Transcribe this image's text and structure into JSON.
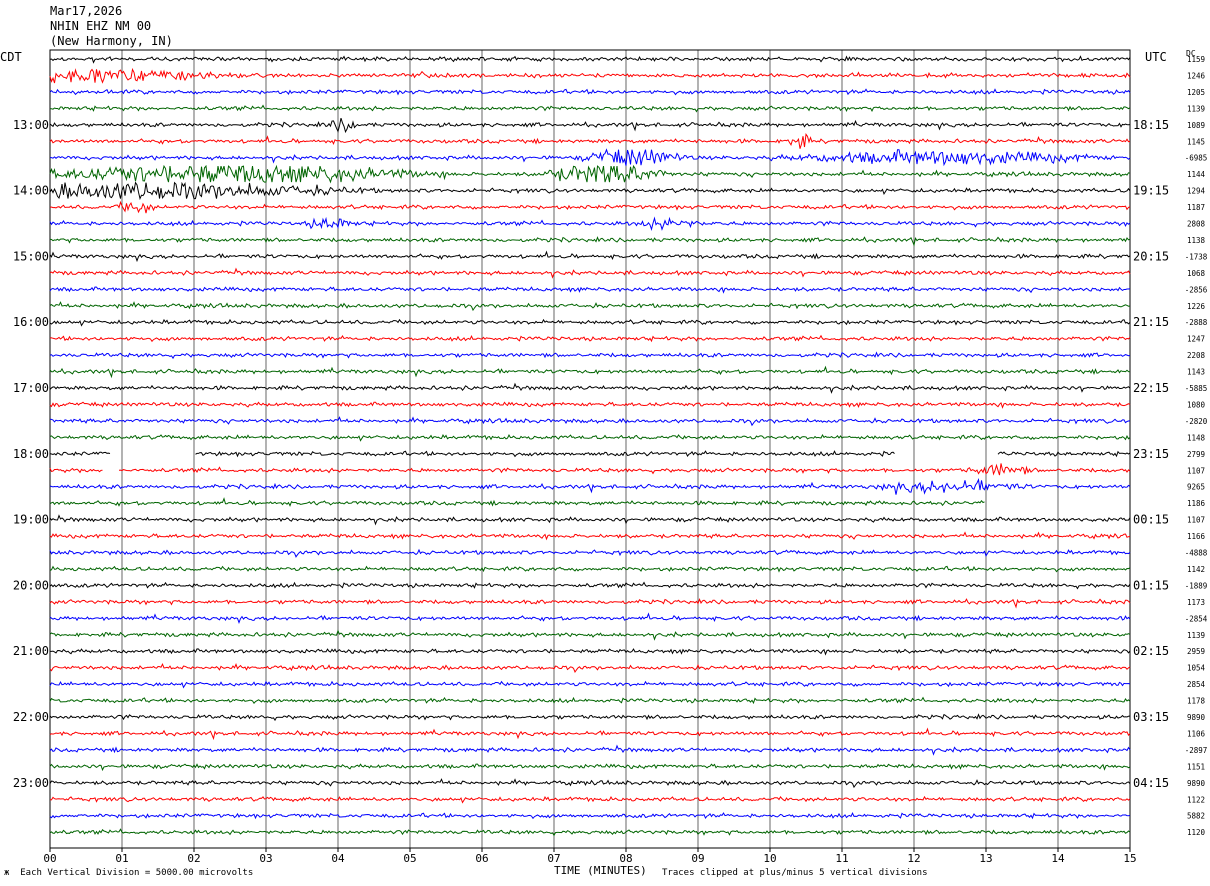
{
  "header": {
    "date": "Mar17,2026",
    "station": "NHIN EHZ NM 00",
    "location": "(New Harmony, IN)"
  },
  "left_zone": "CDT",
  "right_zone": "UTC",
  "dc_label": "DC",
  "footer": {
    "scale_note": "Each Vertical Division = 5000.00 microvolts",
    "xlabel": "TIME (MINUTES)",
    "clip_note": "Traces clipped at plus/minus 5 vertical divisions"
  },
  "colors": {
    "trace_cycle": [
      "#000000",
      "#ff0000",
      "#0000ff",
      "#006400"
    ],
    "grid": "#000000"
  },
  "chart_data": {
    "type": "line",
    "title": "Mar17,2026 NHIN EHZ NM 00 (New Harmony, IN)",
    "xlabel": "TIME (MINUTES)",
    "xlim": [
      0,
      15
    ],
    "x_ticks": [
      "00",
      "01",
      "02",
      "03",
      "04",
      "05",
      "06",
      "07",
      "08",
      "09",
      "10",
      "11",
      "12",
      "13",
      "14",
      "15"
    ],
    "traces_per_hour": 4,
    "left_hour_labels": [
      "13:00",
      "14:00",
      "15:00",
      "16:00",
      "17:00",
      "18:00",
      "19:00",
      "20:00",
      "21:00",
      "22:00",
      "23:00"
    ],
    "right_hour_labels": [
      "18:15",
      "19:15",
      "20:15",
      "21:15",
      "22:15",
      "23:15",
      "00:15",
      "01:15",
      "02:15",
      "03:15",
      "04:15"
    ],
    "dc_offsets": [
      "1159",
      "1246",
      "1205",
      "1139",
      "1089",
      "1145",
      "-6985",
      "1144",
      "1294",
      "1187",
      "2808",
      "1138",
      "-1738",
      "1068",
      "-2856",
      "1226",
      "-2888",
      "1247",
      "2208",
      "1143",
      "-5885",
      "1080",
      "-2820",
      "1148",
      "2799",
      "1107",
      "9265",
      "1186",
      "1107",
      "1166",
      "-4888",
      "1142",
      "-1889",
      "1173",
      "-2854",
      "1139",
      "2959",
      "1054",
      "2854",
      "1178",
      "9890",
      "1106",
      "-2897",
      "1151",
      "9890",
      "1122",
      "5882",
      "1120"
    ],
    "first_trace_minute_offset": 0,
    "gaps": [
      {
        "trace": 24,
        "from": 0.85,
        "to": 2.0
      },
      {
        "trace": 25,
        "from": 0.75,
        "to": 0.95
      },
      {
        "trace": 24,
        "from": 11.75,
        "to": 12.0
      },
      {
        "trace": 27,
        "from": 13.0,
        "to": 15.0
      },
      {
        "trace": 24,
        "from": 12.0,
        "to": 13.15
      }
    ],
    "events": [
      {
        "trace": 1,
        "at": 0.4,
        "width": 2.5,
        "amp": 0.45
      },
      {
        "trace": 4,
        "at": 4.1,
        "width": 0.3,
        "amp": 0.45
      },
      {
        "trace": 5,
        "at": 10.4,
        "width": 0.2,
        "amp": 0.6
      },
      {
        "trace": 6,
        "at": 8.1,
        "width": 0.8,
        "amp": 0.7
      },
      {
        "trace": 6,
        "at": 12.4,
        "width": 2.5,
        "amp": 0.5
      },
      {
        "trace": 7,
        "at": 2.5,
        "width": 3.2,
        "amp": 0.8
      },
      {
        "trace": 7,
        "at": 7.7,
        "width": 1.0,
        "amp": 0.9
      },
      {
        "trace": 8,
        "at": 1.2,
        "width": 3.5,
        "amp": 0.65
      },
      {
        "trace": 9,
        "at": 1.2,
        "width": 0.3,
        "amp": 0.5
      },
      {
        "trace": 10,
        "at": 3.9,
        "width": 0.4,
        "amp": 0.45
      },
      {
        "trace": 10,
        "at": 8.6,
        "width": 0.5,
        "amp": 0.4
      },
      {
        "trace": 25,
        "at": 13.2,
        "width": 0.5,
        "amp": 0.45
      },
      {
        "trace": 26,
        "at": 12.5,
        "width": 1.2,
        "amp": 0.4
      }
    ]
  }
}
